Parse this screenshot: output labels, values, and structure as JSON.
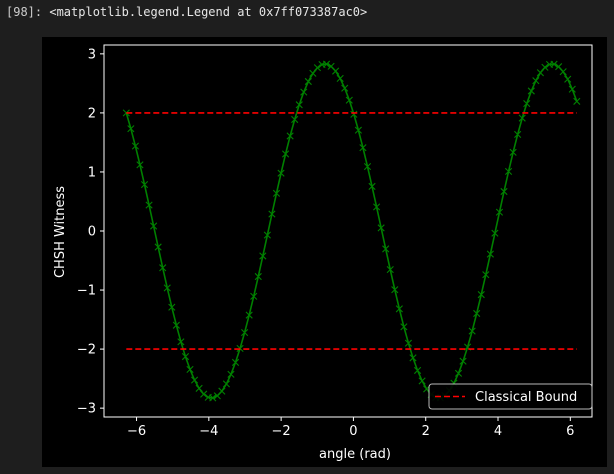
{
  "cell": {
    "prompt": "[98]:",
    "output_text": "<matplotlib.legend.Legend at 0x7ff073387ac0>"
  },
  "colors": {
    "page_background": "#1e1e1e",
    "figure_background": "#000000",
    "witness_line": "#008000",
    "bound_line": "#ff0000",
    "text": "#ffffff"
  },
  "chart_data": {
    "type": "line",
    "title": "",
    "xlabel": "angle (rad)",
    "ylabel": "CHSH Witness",
    "xlim": [
      -6.9,
      6.6
    ],
    "ylim": [
      -3.15,
      3.15
    ],
    "xticks": [
      -6,
      -4,
      -2,
      0,
      2,
      4,
      6
    ],
    "xtick_labels": [
      "−6",
      "−4",
      "−2",
      "0",
      "2",
      "4",
      "6"
    ],
    "yticks": [
      -3,
      -2,
      -1,
      0,
      1,
      2,
      3
    ],
    "ytick_labels": [
      "−3",
      "−2",
      "−1",
      "0",
      "1",
      "2",
      "3"
    ],
    "grid": false,
    "legend_position": "lower-right",
    "series": [
      {
        "name": "",
        "style": "solid line with x markers",
        "color": "#008000",
        "function": "2*sqrt(2)*cos(x + pi/4)",
        "x_range": [
          -6.283,
          6.18
        ],
        "points": 100
      },
      {
        "name": "Classical Bound",
        "style": "dashed",
        "color": "#ff0000",
        "x": [
          -6.283,
          6.18
        ],
        "y": [
          2,
          2
        ]
      },
      {
        "name": "",
        "style": "dashed",
        "color": "#ff0000",
        "x": [
          -6.283,
          6.18
        ],
        "y": [
          -2,
          -2
        ]
      }
    ]
  }
}
